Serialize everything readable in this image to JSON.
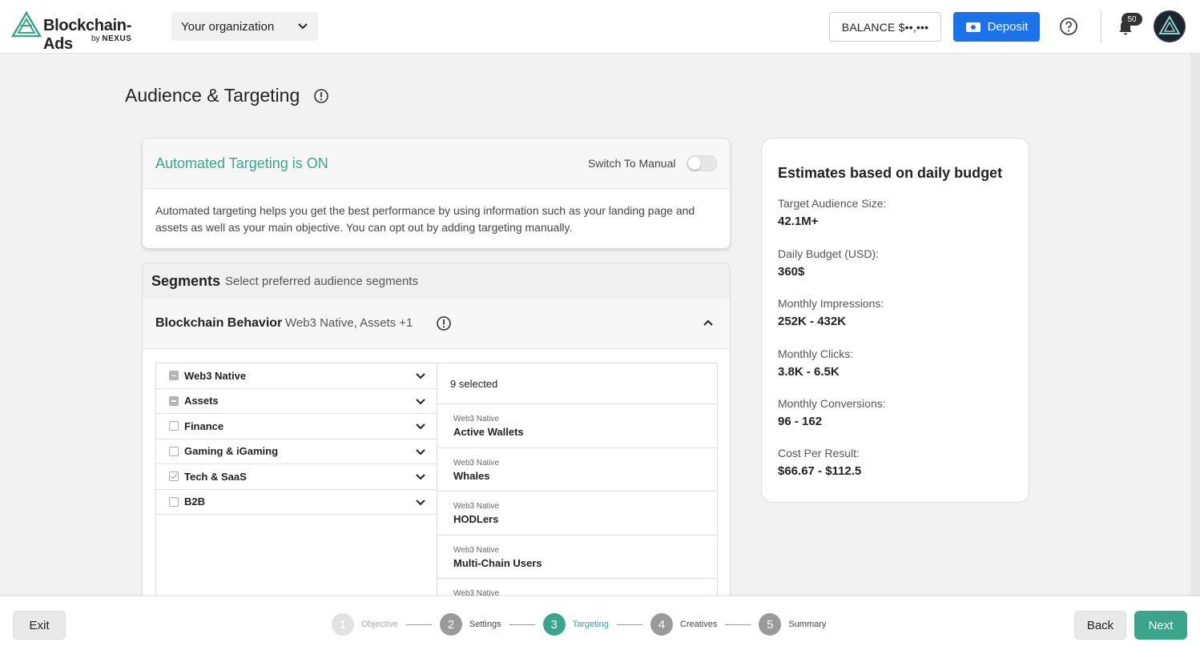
{
  "header": {
    "logo_text": "Blockchain-Ads",
    "logo_by": "by",
    "logo_nexus": "NEXUS",
    "org_select": "Your organization",
    "balance": "BALANCE $••,•••",
    "deposit": "Deposit",
    "notifications_count": "50"
  },
  "page": {
    "title": "Audience & Targeting"
  },
  "automated": {
    "title": "Automated Targeting is ON",
    "switch_label": "Switch To Manual",
    "switch_on": false,
    "description": "Automated targeting helps you get the best performance by using information such as your landing page and assets as well as your main objective. You can opt out by adding targeting manually."
  },
  "segments": {
    "title": "Segments",
    "subtitle": "Select preferred audience segments",
    "behavior_title": "Blockchain Behavior",
    "behavior_summary": "Web3 Native, Assets +1",
    "categories": [
      {
        "label": "Web3 Native",
        "state": "partial"
      },
      {
        "label": "Assets",
        "state": "partial"
      },
      {
        "label": "Finance",
        "state": "unchecked"
      },
      {
        "label": "Gaming & iGaming",
        "state": "unchecked"
      },
      {
        "label": "Tech & SaaS",
        "state": "checked"
      },
      {
        "label": "B2B",
        "state": "unchecked"
      }
    ],
    "selected_count": "9 selected",
    "selected_items": [
      {
        "group": "Web3 Native",
        "name": "Active Wallets"
      },
      {
        "group": "Web3 Native",
        "name": "Whales"
      },
      {
        "group": "Web3 Native",
        "name": "HODLers"
      },
      {
        "group": "Web3 Native",
        "name": "Multi-Chain Users"
      },
      {
        "group": "Web3 Native",
        "name": ""
      }
    ]
  },
  "estimates": {
    "title": "Estimates based on daily budget",
    "items": [
      {
        "label": "Target Audience Size:",
        "value": "42.1M+"
      },
      {
        "label": "Daily Budget (USD):",
        "value": "360$"
      },
      {
        "label": "Monthly Impressions:",
        "value": "252K - 432K"
      },
      {
        "label": "Monthly Clicks:",
        "value": "3.8K - 6.5K"
      },
      {
        "label": "Monthly Conversions:",
        "value": "96 - 162"
      },
      {
        "label": "Cost Per Result:",
        "value": "$66.67 - $112.5"
      }
    ]
  },
  "footer": {
    "exit": "Exit",
    "back": "Back",
    "next": "Next",
    "steps": [
      {
        "num": "1",
        "label": "Objective",
        "state": "disabled"
      },
      {
        "num": "2",
        "label": "Settings",
        "state": "done"
      },
      {
        "num": "3",
        "label": "Targeting",
        "state": "active"
      },
      {
        "num": "4",
        "label": "Creatives",
        "state": "done"
      },
      {
        "num": "5",
        "label": "Summary",
        "state": "done"
      }
    ]
  },
  "colors": {
    "accent_green": "#3aa58a",
    "deposit_blue": "#1a73e8"
  }
}
